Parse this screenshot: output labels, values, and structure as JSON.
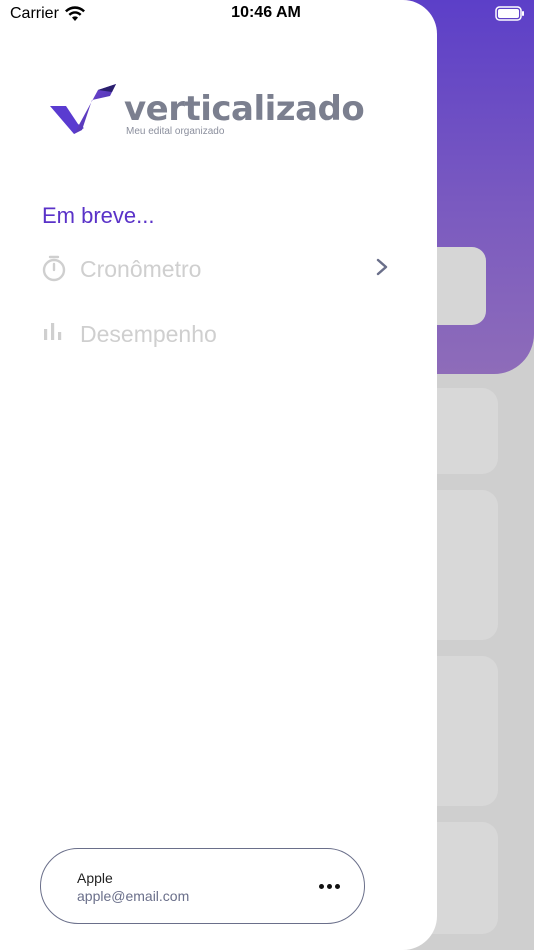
{
  "status_bar": {
    "carrier": "Carrier",
    "time": "10:46 AM",
    "wifi_icon": "wifi-icon",
    "battery_icon": "battery-icon"
  },
  "drawer": {
    "logo": {
      "wordmark": "verticalizado",
      "tagline": "Meu edital organizado"
    },
    "section_title": "Em breve...",
    "menu_items": [
      {
        "label": "Cronômetro",
        "icon": "stopwatch-icon",
        "has_chevron": true
      },
      {
        "label": "Desempenho",
        "icon": "bar-chart-icon",
        "has_chevron": false
      }
    ],
    "account": {
      "name": "Apple",
      "email": "apple@email.com",
      "more_icon": "more-icon"
    }
  },
  "colors": {
    "accent": "#5a32c8",
    "header_gradient_top": "#5c3fc8",
    "header_gradient_bottom": "#8e6cb9",
    "disabled_text": "#cfcfcf",
    "logo_gray": "#7b7f8f"
  }
}
